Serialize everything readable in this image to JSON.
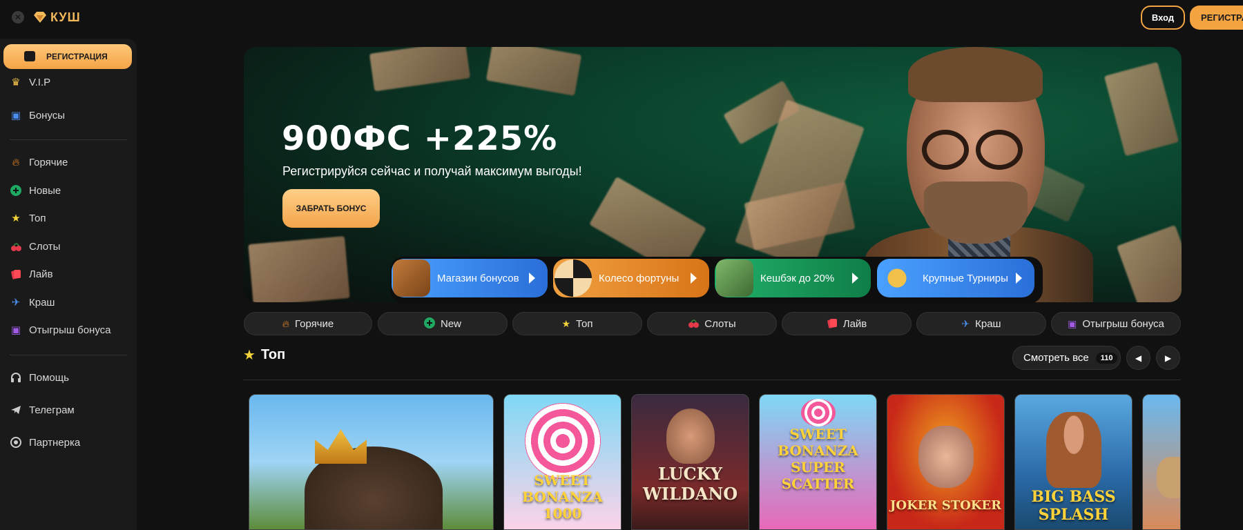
{
  "header": {
    "logo_text": "КУШ",
    "login_label": "Вход",
    "register_label": "РЕГИСТРАЦИЯ"
  },
  "sidebar": {
    "register_label": "РЕГИСТРАЦИЯ",
    "items": [
      {
        "label": "V.I.P",
        "icon": "crown-icon"
      },
      {
        "label": "Бонусы",
        "icon": "gift-icon"
      },
      {
        "label": "Горячие",
        "icon": "fire-icon"
      },
      {
        "label": "Новые",
        "icon": "plus-circle-icon"
      },
      {
        "label": "Топ",
        "icon": "star-icon"
      },
      {
        "label": "Слоты",
        "icon": "cherry-icon"
      },
      {
        "label": "Лайв",
        "icon": "cards-icon"
      },
      {
        "label": "Краш",
        "icon": "plane-icon"
      },
      {
        "label": "Отыгрыш бонуса",
        "icon": "gift-icon"
      },
      {
        "label": "Помощь",
        "icon": "headset-icon"
      },
      {
        "label": "Телеграм",
        "icon": "telegram-icon"
      },
      {
        "label": "Партнерка",
        "icon": "partner-icon"
      }
    ]
  },
  "banner": {
    "title": "900ФС +225%",
    "subtitle": "Регистрируйся сейчас и получай максимум выгоды!",
    "cta_label": "ЗАБРАТЬ БОНУС"
  },
  "promos": [
    {
      "label": "Магазин бонусов",
      "color": "#2f7ee6"
    },
    {
      "label": "Колесо фортуны",
      "color": "#e58a2c"
    },
    {
      "label": "Кешбэк до 20%",
      "color": "#16905a"
    },
    {
      "label": "Крупные Турниры",
      "color": "#2f7ee6"
    }
  ],
  "categories": [
    {
      "label": "Горячие",
      "icon": "fire-icon"
    },
    {
      "label": "New",
      "icon": "plus-circle-icon"
    },
    {
      "label": "Топ",
      "icon": "star-icon"
    },
    {
      "label": "Слоты",
      "icon": "cherry-icon"
    },
    {
      "label": "Лайв",
      "icon": "cards-icon"
    },
    {
      "label": "Краш",
      "icon": "plane-icon"
    },
    {
      "label": "Отыгрыш бонуса",
      "icon": "gift-icon"
    }
  ],
  "section": {
    "title": "Топ",
    "see_all_label": "Смотреть все",
    "count": "110"
  },
  "games": [
    {
      "title": ""
    },
    {
      "title": "SWEET BONANZA 1000"
    },
    {
      "title": "LUCKY WILDANO"
    },
    {
      "title": "SWEET BONANZA SUPER SCATTER"
    },
    {
      "title": "JOKER STOKER"
    },
    {
      "title": "BIG BASS SPLASH"
    },
    {
      "title": ""
    }
  ],
  "colors": {
    "accent": "#f4a341",
    "background": "#111111",
    "sidebar": "#1a1a1a"
  }
}
